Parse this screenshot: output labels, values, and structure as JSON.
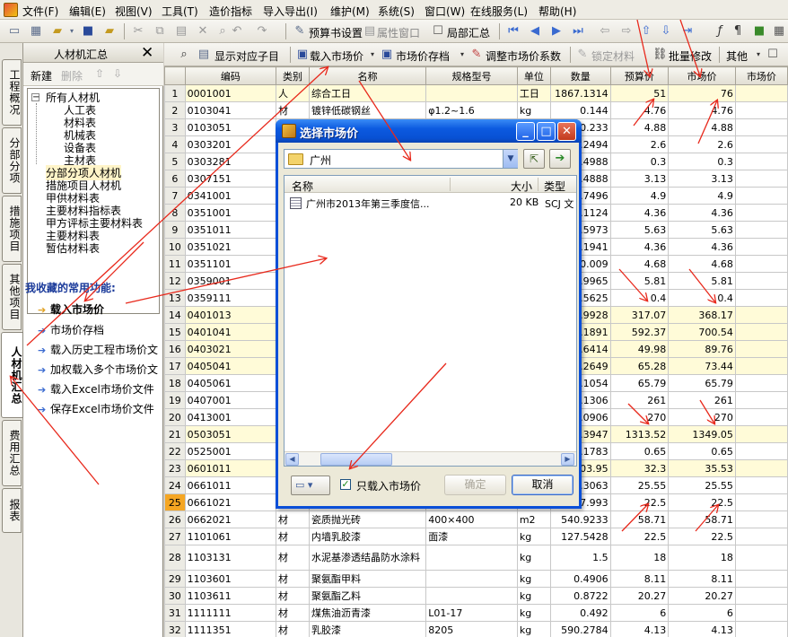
{
  "menubar": {
    "items": [
      "文件(F)",
      "编辑(E)",
      "视图(V)",
      "工具(T)",
      "造价指标",
      "导入导出(I)",
      "维护(M)",
      "系统(S)",
      "窗口(W)",
      "在线服务(L)",
      "帮助(H)"
    ]
  },
  "toolbar1": {
    "budget_settings": "预算书设置",
    "attr_window": "属性窗口",
    "local_summary": "局部汇总"
  },
  "lefttabs": [
    "工程概况",
    "分部分项",
    "措施项目",
    "其他项目",
    "人材机汇总",
    "费用汇总",
    "报表"
  ],
  "leftpanel": {
    "title": "人材机汇总",
    "new": "新建",
    "delete": "删除",
    "tree": [
      "所有人材机",
      "人工表",
      "材料表",
      "机械表",
      "设备表",
      "主材表",
      "分部分项人材机",
      "措施项目人材机",
      "甲供材料表",
      "主要材料指标表",
      "甲方评标主要材料表",
      "主要材料表",
      "暂估材料表"
    ],
    "fav_title": "我收藏的常用功能:",
    "favs": [
      "载入市场价",
      "市场价存档",
      "载入历史工程市场价文",
      "加权载入多个市场价文",
      "载入Excel市场价文件",
      "保存Excel市场价文件"
    ]
  },
  "toolbar2": {
    "show_sub": "显示对应子目",
    "load_price": "载入市场价",
    "archive": "市场价存档",
    "adjust": "调整市场价系数",
    "lock": "锁定材料",
    "batch": "批量修改",
    "other": "其他"
  },
  "grid": {
    "headers": [
      "编码",
      "类别",
      "名称",
      "规格型号",
      "单位",
      "数量",
      "预算价",
      "市场价",
      "市场价"
    ],
    "rows": [
      {
        "n": "1",
        "code": "0001001",
        "cat": "人",
        "name": "综合工日",
        "spec": "",
        "unit": "工日",
        "qty": "1867.1314",
        "budget": "51",
        "market": "76",
        "hl": true
      },
      {
        "n": "2",
        "code": "0103041",
        "cat": "材",
        "name": "镀锌低碳钢丝",
        "spec": "φ1.2~1.6",
        "unit": "kg",
        "qty": "0.144",
        "budget": "4.76",
        "market": "4.76"
      },
      {
        "n": "3",
        "code": "0103051",
        "cat": "材",
        "name": "",
        "spec": "",
        "unit": "",
        "qty": "0.233",
        "budget": "4.88",
        "market": "4.88"
      },
      {
        "n": "4",
        "code": "0303201",
        "cat": "",
        "name": "",
        "spec": "",
        "unit": "",
        "qty": "5.2494",
        "budget": "2.6",
        "market": "2.6"
      },
      {
        "n": "5",
        "code": "0303281",
        "cat": "",
        "name": "",
        "spec": "",
        "unit": "",
        "qty": "0.4988",
        "budget": "0.3",
        "market": "0.3"
      },
      {
        "n": "6",
        "code": "0307151",
        "cat": "",
        "name": "",
        "spec": "",
        "unit": "",
        "qty": "5.4888",
        "budget": "3.13",
        "market": "3.13"
      },
      {
        "n": "7",
        "code": "0341001",
        "cat": "",
        "name": "",
        "spec": "",
        "unit": "",
        "qty": "4.7496",
        "budget": "4.9",
        "market": "4.9"
      },
      {
        "n": "8",
        "code": "0351001",
        "cat": "",
        "name": "",
        "spec": "",
        "unit": "",
        "qty": "7.1124",
        "budget": "4.36",
        "market": "4.36"
      },
      {
        "n": "9",
        "code": "0351011",
        "cat": "",
        "name": "",
        "spec": "",
        "unit": "",
        "qty": "0.5973",
        "budget": "5.63",
        "market": "5.63"
      },
      {
        "n": "10",
        "code": "0351021",
        "cat": "",
        "name": "",
        "spec": "",
        "unit": "",
        "qty": "2.1941",
        "budget": "4.36",
        "market": "4.36"
      },
      {
        "n": "11",
        "code": "0351101",
        "cat": "",
        "name": "",
        "spec": "",
        "unit": "",
        "qty": "0.009",
        "budget": "4.68",
        "market": "4.68"
      },
      {
        "n": "12",
        "code": "0359001",
        "cat": "",
        "name": "",
        "spec": "",
        "unit": "",
        "qty": "7.9965",
        "budget": "5.81",
        "market": "5.81"
      },
      {
        "n": "13",
        "code": "0359111",
        "cat": "",
        "name": "",
        "spec": "",
        "unit": "",
        "qty": "9.5625",
        "budget": "0.4",
        "market": "0.4"
      },
      {
        "n": "14",
        "code": "0401013",
        "cat": "",
        "name": "",
        "spec": "",
        "unit": "",
        "qty": "0.9928",
        "budget": "317.07",
        "market": "368.17",
        "hl": true
      },
      {
        "n": "15",
        "code": "0401041",
        "cat": "",
        "name": "",
        "spec": "",
        "unit": "",
        "qty": "0.1891",
        "budget": "592.37",
        "market": "700.54",
        "hl": true
      },
      {
        "n": "16",
        "code": "0403021",
        "cat": "",
        "name": "",
        "spec": "",
        "unit": "",
        "qty": "0.6414",
        "budget": "49.98",
        "market": "89.76",
        "hl": true
      },
      {
        "n": "17",
        "code": "0405041",
        "cat": "",
        "name": "",
        "spec": "",
        "unit": "",
        "qty": "0.2649",
        "budget": "65.28",
        "market": "73.44",
        "hl": true
      },
      {
        "n": "18",
        "code": "0405061",
        "cat": "",
        "name": "",
        "spec": "",
        "unit": "",
        "qty": "0.1054",
        "budget": "65.79",
        "market": "65.79"
      },
      {
        "n": "19",
        "code": "0407001",
        "cat": "",
        "name": "",
        "spec": "",
        "unit": "",
        "qty": "0.1306",
        "budget": "261",
        "market": "261"
      },
      {
        "n": "20",
        "code": "0413001",
        "cat": "",
        "name": "",
        "spec": "",
        "unit": "",
        "qty": "0.0906",
        "budget": "270",
        "market": "270"
      },
      {
        "n": "21",
        "code": "0503051",
        "cat": "",
        "name": "",
        "spec": "",
        "unit": "",
        "qty": "0.3947",
        "budget": "1313.52",
        "market": "1349.05",
        "hl": true
      },
      {
        "n": "22",
        "code": "0525001",
        "cat": "",
        "name": "",
        "spec": "",
        "unit": "",
        "qty": "2.1783",
        "budget": "0.65",
        "market": "0.65"
      },
      {
        "n": "23",
        "code": "0601011",
        "cat": "",
        "name": "",
        "spec": "",
        "unit": "",
        "qty": "103.95",
        "budget": "32.3",
        "market": "35.53",
        "hl": true
      },
      {
        "n": "24",
        "code": "0661011",
        "cat": "",
        "name": "",
        "spec": "",
        "unit": "",
        "qty": "6.3063",
        "budget": "25.55",
        "market": "25.55"
      },
      {
        "n": "25",
        "code": "0661021",
        "cat": "",
        "name": "",
        "spec": "",
        "unit": "",
        "qty": "87.993",
        "budget": "22.5",
        "market": "22.5",
        "sel": true
      },
      {
        "n": "26",
        "code": "0662021",
        "cat": "材",
        "name": "瓷质抛光砖",
        "spec": "400×400",
        "unit": "m2",
        "qty": "540.9233",
        "budget": "58.71",
        "market": "58.71"
      },
      {
        "n": "27",
        "code": "1101061",
        "cat": "材",
        "name": "内墙乳胶漆",
        "spec": "面漆",
        "unit": "kg",
        "qty": "127.5428",
        "budget": "22.5",
        "market": "22.5"
      },
      {
        "n": "28",
        "code": "1103131",
        "cat": "材",
        "name": "水泥基渗透结晶防水涂料",
        "spec": "",
        "unit": "kg",
        "qty": "1.5",
        "budget": "18",
        "market": "18",
        "tall": true
      },
      {
        "n": "29",
        "code": "1103601",
        "cat": "材",
        "name": "聚氨酯甲料",
        "spec": "",
        "unit": "kg",
        "qty": "0.4906",
        "budget": "8.11",
        "market": "8.11"
      },
      {
        "n": "30",
        "code": "1103611",
        "cat": "材",
        "name": "聚氨酯乙料",
        "spec": "",
        "unit": "kg",
        "qty": "0.8722",
        "budget": "20.27",
        "market": "20.27"
      },
      {
        "n": "31",
        "code": "1111111",
        "cat": "材",
        "name": "煤焦油沥青漆",
        "spec": "L01-17",
        "unit": "kg",
        "qty": "0.492",
        "budget": "6",
        "market": "6"
      },
      {
        "n": "32",
        "code": "1111351",
        "cat": "材",
        "name": "乳胶漆",
        "spec": "8205",
        "unit": "kg",
        "qty": "590.2784",
        "budget": "4.13",
        "market": "4.13"
      }
    ]
  },
  "dialog": {
    "title": "选择市场价",
    "path": "广州",
    "col_name": "名称",
    "col_size": "大小",
    "col_type": "类型",
    "file_name": "广州市2013年第三季度信...",
    "file_size": "20 KB",
    "file_type": "SCJ 文",
    "checkbox_label": "只载入市场价",
    "ok": "确定",
    "cancel": "取消"
  },
  "colors": {
    "titlebar": "#0851d4",
    "highlight_row": "#fffbd8",
    "selected_rownum": "#f5a623",
    "annotation_arrow": "#e8291c"
  }
}
